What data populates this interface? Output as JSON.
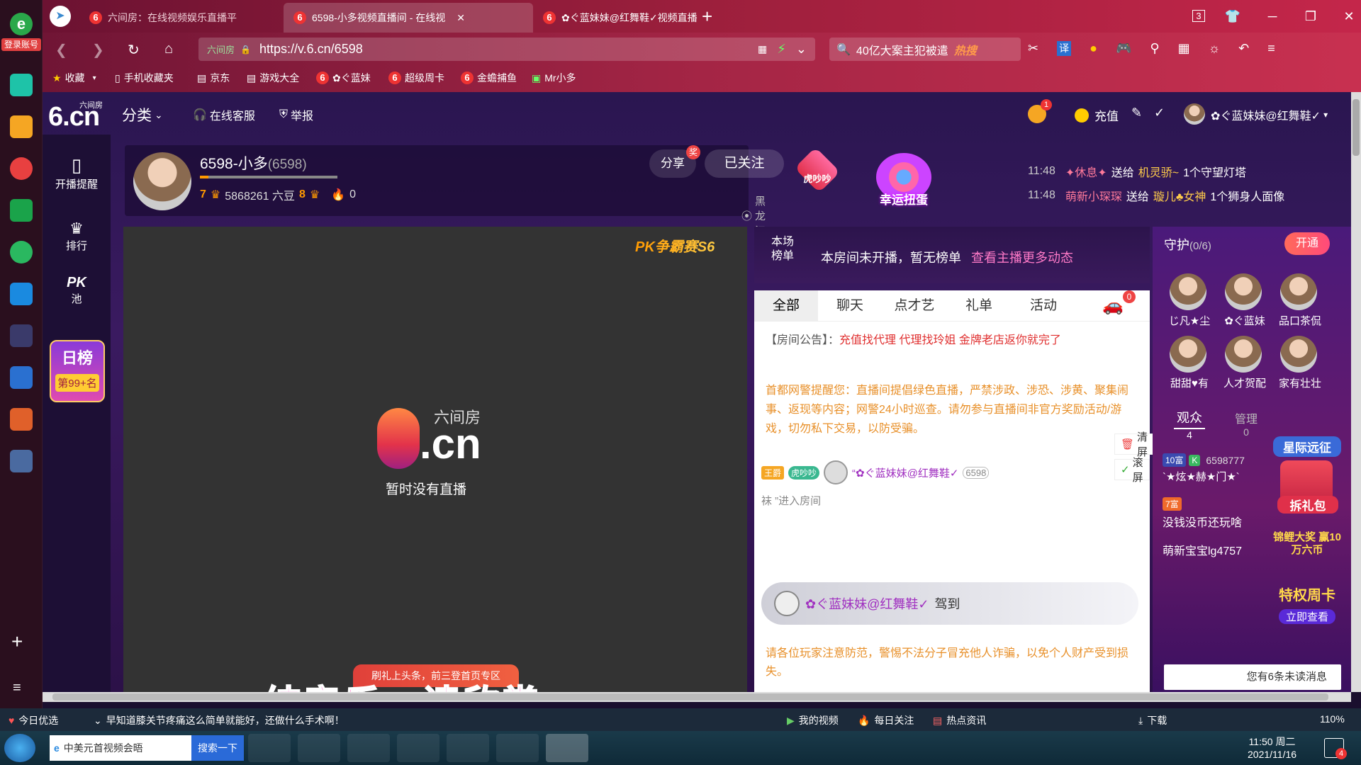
{
  "browser": {
    "login_label": "登录账号",
    "tabs": [
      {
        "title": "六间房：在线视频娱乐直播平"
      },
      {
        "title": "6598-小多视频直播间 - 在线视"
      },
      {
        "title": "✿ぐ蓝妹妹@红舞鞋✓视频直播"
      }
    ],
    "tab_count": "3",
    "url_prefix": "六间房",
    "url": "https://v.6.cn/6598",
    "search_text": "40亿大案主犯被遣",
    "search_badge": "热搜",
    "translate_label": "译",
    "bookmarks": [
      "收藏",
      "手机收藏夹",
      "京东",
      "游戏大全",
      "✿ぐ蓝妹",
      "超级周卡",
      "金蟾捕鱼",
      "Mr小多"
    ]
  },
  "site": {
    "logo_sub": "六间房",
    "logo_main": "6.cn",
    "category": "分类",
    "service": "在线客服",
    "report": "举报",
    "notif_count": "1",
    "recharge": "充值",
    "user_name": "✿ぐ蓝妹妹@红舞鞋✓"
  },
  "left_menu": {
    "remind": "开播提醒",
    "rank": "排行",
    "pk": "PK",
    "pk_sub": "池",
    "day_rank": "日榜",
    "day_rank_pos": "第99+名"
  },
  "anchor": {
    "name": "6598-小多",
    "rid": "(6598)",
    "level_left": "7",
    "beans": "5868261 六豆",
    "level_right": "8",
    "fire": "0",
    "share": "分享",
    "share_badge": "奖",
    "follow": "已关注",
    "location": "黑龙江"
  },
  "promo": {
    "badge1": "虎吵吵",
    "badge2": "幸运扭蛋",
    "messages": [
      {
        "time": "11:48",
        "from": "✦休息✦",
        "verb": "送给",
        "to": "机灵骄~",
        "gift": "1个守望灯塔"
      },
      {
        "time": "11:48",
        "from": "萌新小琛琛",
        "verb": "送给",
        "to": "璇儿♣女神",
        "gift": "1个狮身人面像"
      }
    ]
  },
  "video": {
    "event_logo": "PK争霸赛S6",
    "logo_sub": "六间房",
    "logo_main": ".cn",
    "no_live": "暂时没有直播",
    "promo_banner": "刷礼上头条，前三登首页专区",
    "subtitle": "纯音乐，请欣赏"
  },
  "rank": {
    "label": "本场榜单",
    "empty": "本房间未开播，暂无榜单",
    "more": "查看主播更多动态",
    "tabs": [
      "全部",
      "聊天",
      "点才艺",
      "礼单",
      "活动"
    ],
    "car_badge": "0",
    "notice_label": "【房间公告】：",
    "notice": "充值找代理 代理找玲姐 金牌老店返你就完了",
    "warning": "首都网警提醒您：直播间提倡绿色直播，严禁涉政、涉恐、涉黄、聚集闹事、返现等内容；网警24小时巡查。请勿参与直播间非官方奖励活动/游戏，切勿私下交易，以防受骗。",
    "clear": "清屏",
    "scroll": "滚屏",
    "entry_badge1": "王爵",
    "entry_badge2": "虎吵吵",
    "entry_name": "“✿ぐ蓝妹妹@红舞鞋✓",
    "entry_id": "6598",
    "entry_suffix": "袜 ”进入房间",
    "checkin_name": "✿ぐ蓝妹妹@红舞鞋✓",
    "checkin": "驾到",
    "footer": "请各位玩家注意防范，警惕不法分子冒充他人诈骗，以免个人财产受到损失。"
  },
  "guard": {
    "title": "守护",
    "count": "(0/6)",
    "open": "开通",
    "members": [
      "じ凡★尘",
      "✿ぐ蓝妹",
      "品口茶侃",
      "甜甜♥有",
      "人才贺配",
      "家有壮壮"
    ],
    "audience_label": "观众",
    "audience_count": "4",
    "admin_label": "管理",
    "admin_count": "0",
    "viewers": [
      {
        "badge": "10富",
        "name": "6598777",
        "nick": "`★炫★赫★门★`"
      },
      {
        "badge": "7富",
        "name": "没钱没币还玩啥"
      },
      {
        "badge": "",
        "name": "萌新宝宝lg4757"
      }
    ],
    "promo1": "星际远征",
    "promo2": "拆礼包",
    "promo3": "锦鲤大奖 赢10万六币",
    "promo4": "特权周卡",
    "promo4_sub": "立即查看",
    "unread": "您有6条未读消息"
  },
  "statusbar": {
    "today": "今日优选",
    "news": "早知道膝关节疼痛这么简单就能好，还做什么手术啊！",
    "items": [
      "我的视频",
      "每日关注",
      "热点资讯",
      "下载"
    ],
    "zoom": "110%"
  },
  "taskbar": {
    "app1": "中美元首视频会晤",
    "search": "搜索一下",
    "time": "11:50 周二",
    "date": "2021/11/16",
    "notif": "4"
  }
}
